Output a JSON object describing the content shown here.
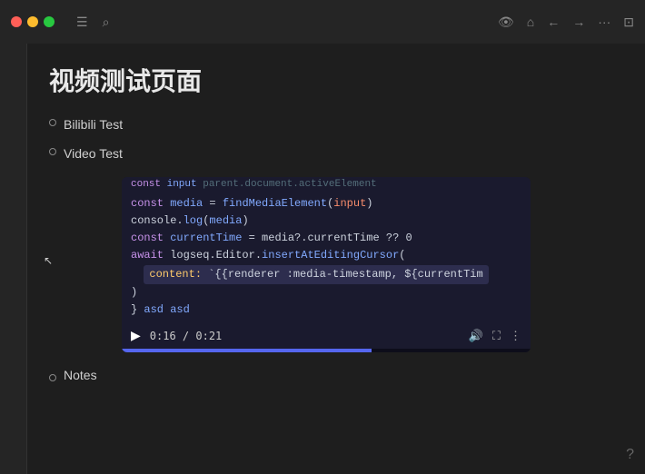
{
  "titlebar": {
    "traffic_lights": [
      "red",
      "yellow",
      "green"
    ],
    "icons": [
      "hamburger",
      "search"
    ],
    "right_icons": [
      "eye",
      "home",
      "back",
      "forward",
      "more",
      "sidebar"
    ]
  },
  "page": {
    "title": "视频测试页面",
    "bullets": [
      {
        "id": "bilibili",
        "label": "Bilibili Test",
        "type": "outline"
      },
      {
        "id": "video",
        "label": "Video Test",
        "type": "outline"
      }
    ],
    "code_lines": [
      {
        "id": "line0",
        "text": "const input   parent.document.activeElement"
      },
      {
        "id": "line1",
        "tokens": [
          {
            "t": "keyword",
            "v": "const "
          },
          {
            "t": "var",
            "v": "media"
          },
          {
            "t": "plain",
            "v": " = "
          },
          {
            "t": "fn",
            "v": "findMediaElement"
          },
          {
            "t": "plain",
            "v": "("
          },
          {
            "t": "param",
            "v": "input"
          },
          {
            "t": "plain",
            "v": ")"
          }
        ]
      },
      {
        "id": "line2",
        "tokens": [
          {
            "t": "plain",
            "v": "console."
          },
          {
            "t": "fn",
            "v": "log"
          },
          {
            "t": "plain",
            "v": "("
          },
          {
            "t": "var",
            "v": "media"
          },
          {
            "t": "plain",
            "v": ")"
          }
        ]
      },
      {
        "id": "line3",
        "tokens": [
          {
            "t": "keyword",
            "v": "const "
          },
          {
            "t": "var",
            "v": "currentTime"
          },
          {
            "t": "plain",
            "v": " = media?.currentTime ?? 0"
          }
        ]
      },
      {
        "id": "line4",
        "tokens": [
          {
            "t": "keyword",
            "v": "await "
          },
          {
            "t": "plain",
            "v": "logseq.Editor."
          },
          {
            "t": "fn",
            "v": "insertAtEditingCursor"
          },
          {
            "t": "plain",
            "v": "("
          }
        ]
      },
      {
        "id": "line5",
        "highlight": true,
        "tokens": [
          {
            "t": "orange",
            "v": "content:"
          },
          {
            "t": "plain",
            "v": " `{{renderer :media-timestamp, ${currentTim"
          }
        ]
      },
      {
        "id": "line6",
        "tokens": [
          {
            "t": "plain",
            "v": ")"
          }
        ]
      },
      {
        "id": "line7",
        "tokens": [
          {
            "t": "plain",
            "v": "} "
          },
          {
            "t": "var",
            "v": "asd"
          },
          {
            "t": "plain",
            "v": " "
          },
          {
            "t": "var",
            "v": "asd"
          }
        ]
      }
    ],
    "video_controls": {
      "time_current": "0:16",
      "time_total": "0:21",
      "progress_percent": 61
    },
    "notes_label": "Notes"
  },
  "help": "?"
}
